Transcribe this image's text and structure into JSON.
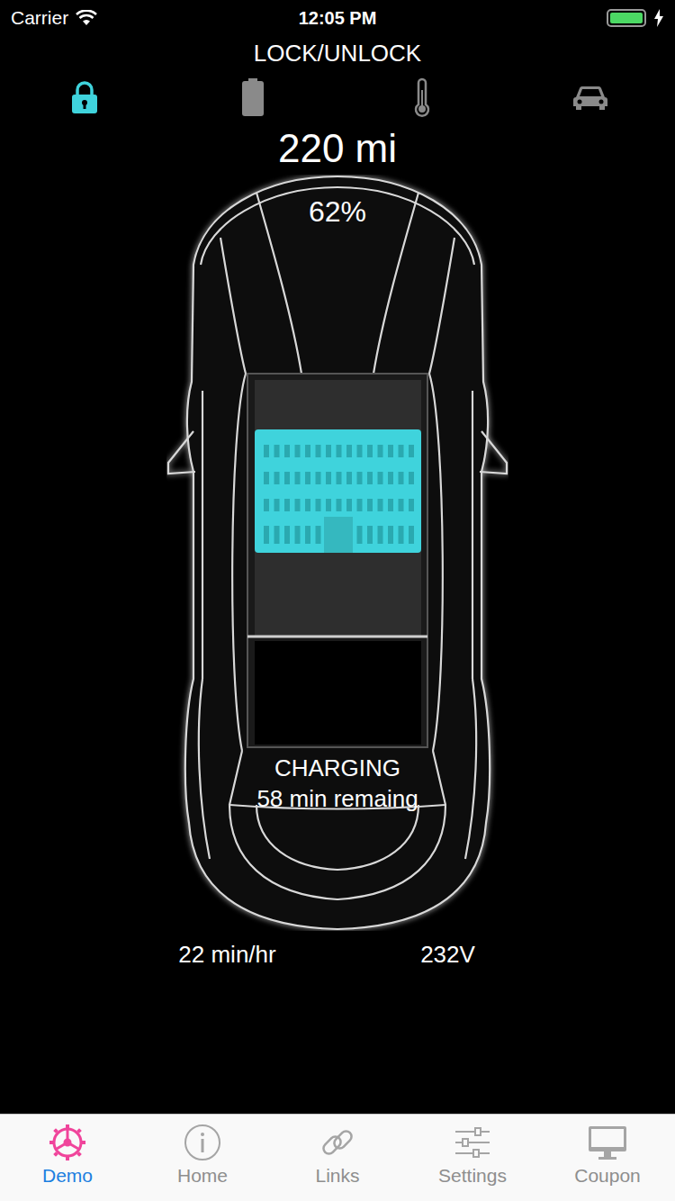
{
  "status_bar": {
    "carrier": "Carrier",
    "time": "12:05 PM",
    "battery_level": 1.0,
    "charging": true
  },
  "title": "LOCK/UNLOCK",
  "modes": [
    {
      "kind": "lock",
      "selected": true
    },
    {
      "kind": "battery",
      "selected": false
    },
    {
      "kind": "thermometer",
      "selected": false
    },
    {
      "kind": "car",
      "selected": false
    }
  ],
  "range": "220 mi",
  "percent": "62%",
  "charge": {
    "status": "CHARGING",
    "remaining": "58 min remaing"
  },
  "rate": "22 min/hr",
  "voltage": "232V",
  "tabs": [
    {
      "label": "Demo",
      "kind": "demo",
      "selected": true
    },
    {
      "label": "Home",
      "kind": "info",
      "selected": false
    },
    {
      "label": "Links",
      "kind": "link",
      "selected": false
    },
    {
      "label": "Settings",
      "kind": "sliders",
      "selected": false
    },
    {
      "label": "Coupon",
      "kind": "monitor",
      "selected": false
    }
  ]
}
